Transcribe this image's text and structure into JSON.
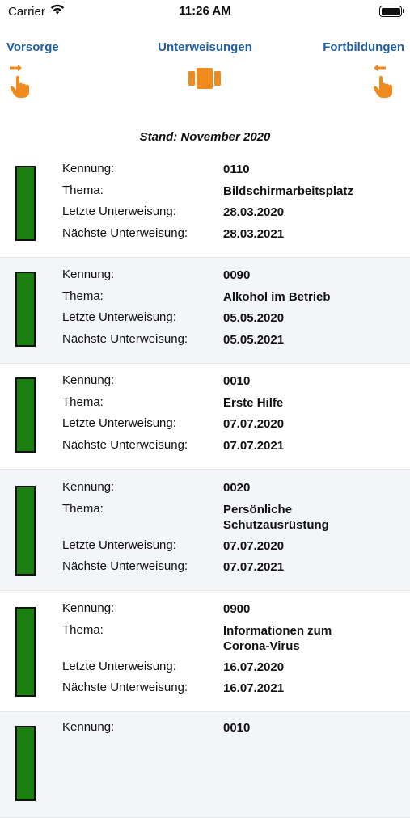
{
  "status": {
    "carrier": "Carrier",
    "time": "11:26 AM"
  },
  "nav": {
    "left": "Vorsorge",
    "center": "Unterweisungen",
    "right": "Fortbildungen",
    "accent_color": "#f08a1c",
    "link_color": "#1f5fa8"
  },
  "stand": "Stand: November 2020",
  "labels": {
    "kennung": "Kennung:",
    "thema": "Thema:",
    "letzte": "Letzte Unterweisung:",
    "naechste": "Nächste Unterweisung:"
  },
  "status_color": "#1a7f0e",
  "items": [
    {
      "kennung": "0110",
      "thema": "Bildschirmarbeitsplatz",
      "letzte": "28.03.2020",
      "naechste": "28.03.2021"
    },
    {
      "kennung": "0090",
      "thema": "Alkohol im Betrieb",
      "letzte": "05.05.2020",
      "naechste": "05.05.2021"
    },
    {
      "kennung": "0010",
      "thema": "Erste Hilfe",
      "letzte": "07.07.2020",
      "naechste": "07.07.2021"
    },
    {
      "kennung": "0020",
      "thema_line1": "Persönliche",
      "thema_line2": "Schutzausrüstung",
      "letzte": "07.07.2020",
      "naechste": "07.07.2021"
    },
    {
      "kennung": "0900",
      "thema_line1": "Informationen zum",
      "thema_line2": "Corona-Virus",
      "letzte": "16.07.2020",
      "naechste": "16.07.2021"
    },
    {
      "kennung_partial": "Kennung:",
      "kennung": "0010"
    }
  ]
}
